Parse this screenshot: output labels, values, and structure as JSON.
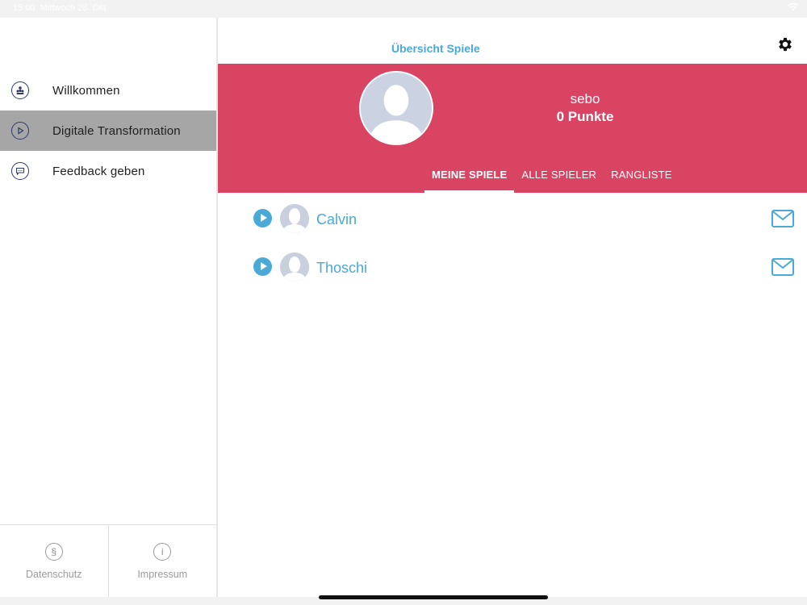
{
  "status_bar": {
    "time": "15:00",
    "date": "Mittwoch 28. Okt"
  },
  "sidebar": {
    "items": [
      {
        "label": "Willkommen",
        "icon": "people-icon"
      },
      {
        "label": "Digitale Transformation",
        "icon": "play-icon",
        "active": true
      },
      {
        "label": "Feedback geben",
        "icon": "feedback-icon"
      }
    ],
    "footer": [
      {
        "label": "Datenschutz",
        "icon": "§"
      },
      {
        "label": "Impressum",
        "icon": "i"
      }
    ]
  },
  "header": {
    "title": "Übersicht Spiele"
  },
  "profile": {
    "username": "sebo",
    "points": "0 Punkte"
  },
  "tabs": [
    {
      "label": "MEINE SPIELE",
      "active": true
    },
    {
      "label": "ALLE SPIELER"
    },
    {
      "label": "RANGLISTE"
    }
  ],
  "games": [
    {
      "name": "Calvin"
    },
    {
      "name": "Thoschi"
    }
  ],
  "colors": {
    "accent_blue": "#4aa9d6",
    "profile_red": "#d94463",
    "active_menu": "#a6a6a6"
  }
}
